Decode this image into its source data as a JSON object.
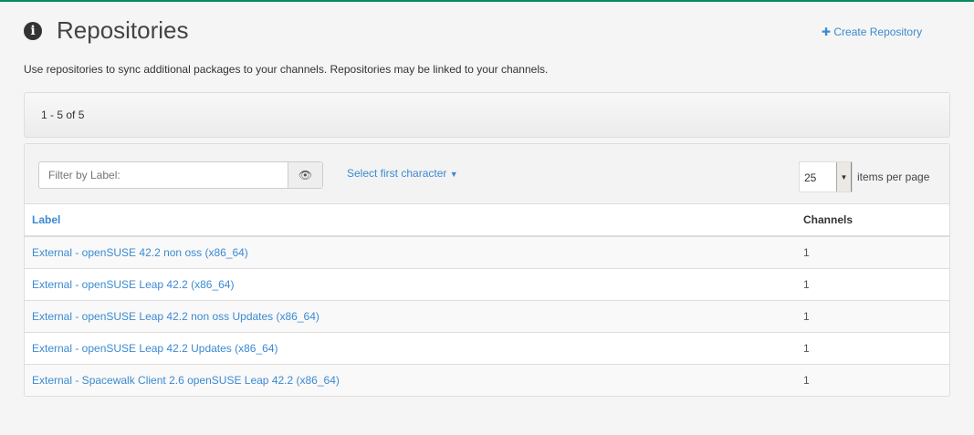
{
  "header": {
    "title": "Repositories",
    "create_label": "Create Repository",
    "description": "Use repositories to sync additional packages to your channels. Repositories may be linked to your channels."
  },
  "pagination": {
    "range": "1 - 5 of 5"
  },
  "toolbar": {
    "filter_placeholder": "Filter by Label:",
    "select_first_char": "Select first character",
    "items_per_page_value": "25",
    "items_per_page_label": "items per page"
  },
  "table": {
    "columns": [
      "Label",
      "Channels"
    ],
    "rows": [
      {
        "label": "External - openSUSE 42.2 non oss (x86_64)",
        "channels": "1"
      },
      {
        "label": "External - openSUSE Leap 42.2 (x86_64)",
        "channels": "1"
      },
      {
        "label": "External - openSUSE Leap 42.2 non oss Updates (x86_64)",
        "channels": "1"
      },
      {
        "label": "External - openSUSE Leap 42.2 Updates (x86_64)",
        "channels": "1"
      },
      {
        "label": "External - Spacewalk Client 2.6 openSUSE Leap 42.2 (x86_64)",
        "channels": "1"
      }
    ]
  }
}
